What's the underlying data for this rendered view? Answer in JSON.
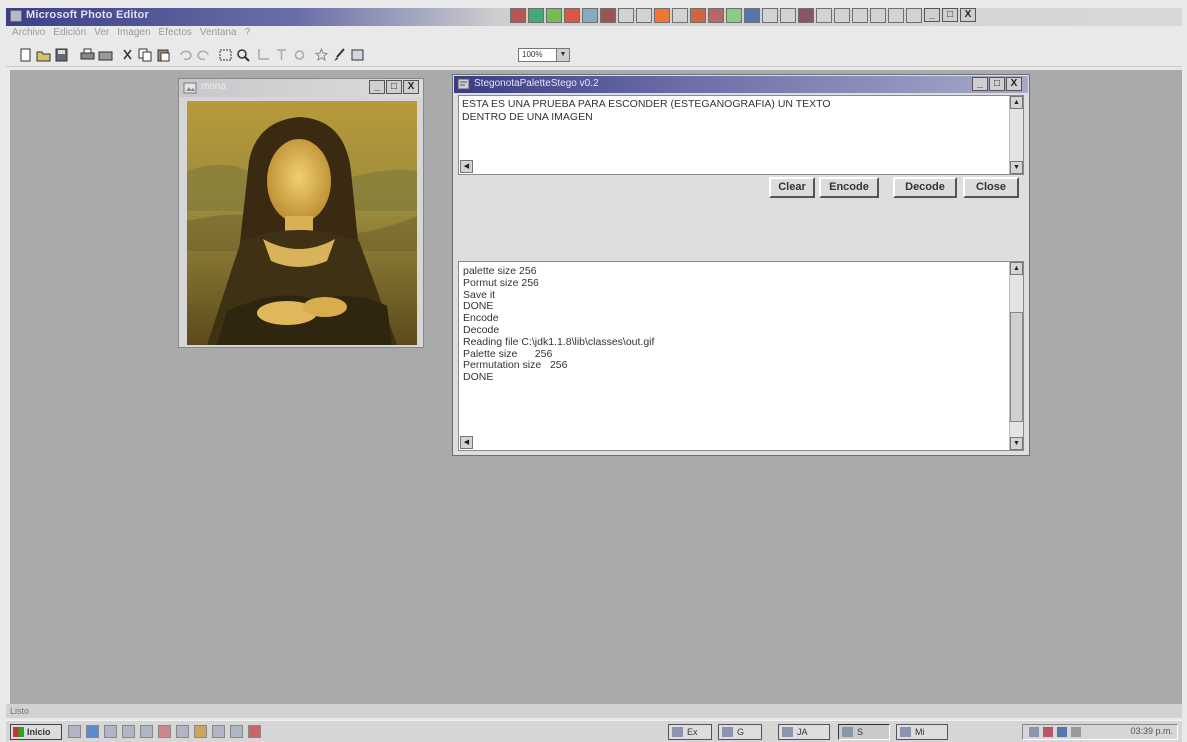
{
  "app": {
    "title": "Microsoft Photo Editor",
    "menu": [
      "Archivo",
      "Edición",
      "Ver",
      "Imagen",
      "Efectos",
      "Ventana",
      "?"
    ],
    "zoom": "100%",
    "window_buttons": [
      "_",
      "□",
      "X"
    ]
  },
  "image_window": {
    "title": "mona",
    "window_buttons": [
      "_",
      "□",
      "X"
    ]
  },
  "stego_window": {
    "title": "StegonotaPaletteStego v0.2",
    "window_buttons": [
      "_",
      "□",
      "X"
    ],
    "message_text": "ESTA ES UNA PRUEBA PARA ESCONDER (ESTEGANOGRAFIA) UN TEXTO\nDENTRO DE UNA IMAGEN",
    "buttons": [
      "Clear",
      "Encode",
      "Decode",
      "Close"
    ],
    "log_lines": [
      "palette size 256",
      "Pormut size 256",
      "Save it",
      "DONE",
      "Encode",
      "Decode",
      "Reading file C:\\jdk1.1.8\\lib\\classes\\out.gif",
      "Palette size      256",
      "Permutation size   256",
      "DONE"
    ]
  },
  "status_bar": {
    "text": "Listo"
  },
  "taskbar": {
    "start_label": "Inicio",
    "tasks": [
      "Ex",
      "G",
      "JA",
      "S",
      "Mi"
    ],
    "clock": "03:39 p.m."
  },
  "colors": {
    "active_title": "#3a3c84",
    "workspace": "#a9aaab",
    "window_face": "#dedede"
  }
}
